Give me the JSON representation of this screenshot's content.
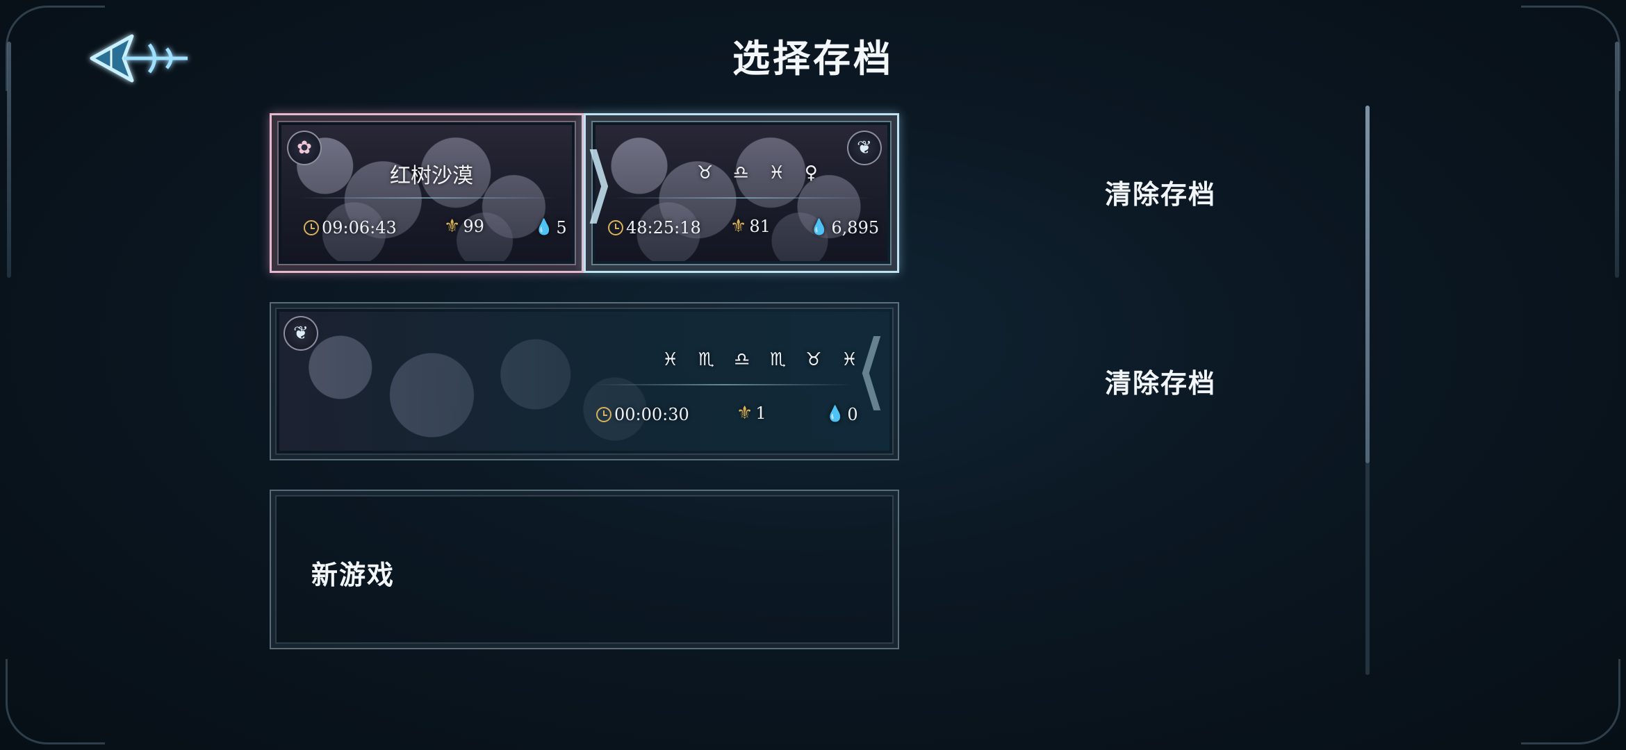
{
  "screen": {
    "title": "选择存档",
    "back_icon": "ornate-arrow-back-icon"
  },
  "slots": [
    {
      "primary": {
        "emblem_icon": "rose-icon",
        "area_name": "红树沙漠",
        "time": "09:06:43",
        "level": "99",
        "currency": "5"
      },
      "secondary": {
        "emblem_icon": "spirit-icon",
        "area_name": "♉ ♎ ♓ ♀",
        "time": "48:25:18",
        "level": "81",
        "currency": "6,895"
      },
      "clear_label": "清除存档"
    },
    {
      "primary": {
        "emblem_icon": "spirit-icon",
        "area_name": "♓ ♏ ♎ ♏ ♉ ♓",
        "time": "00:00:30",
        "level": "1",
        "currency": "0"
      },
      "clear_label": "清除存档"
    },
    {
      "new_game_label": "新游戏"
    }
  ],
  "colors": {
    "accent_pink": "#e6b9cf",
    "accent_blue": "#bfe3f2",
    "gold": "#d9b25a",
    "water": "#8fd0f2"
  }
}
